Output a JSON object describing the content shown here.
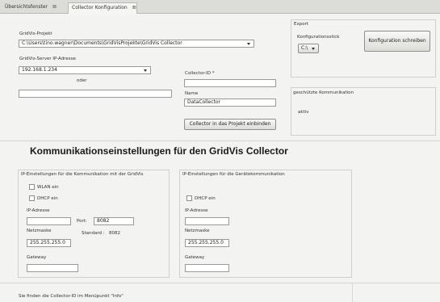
{
  "tabs": [
    {
      "label": "Übersichtsfenster",
      "close": "⊠"
    },
    {
      "label": "Collector Konfiguration",
      "close": "⊠"
    }
  ],
  "gridvis": {
    "project_label": "GridVis-Projekt",
    "project_value": "C:\\Users\\tino.wagner\\Documents\\GridVisProjekte\\GridVis Collector",
    "server_label": "GridVis-Server IP-Adresse",
    "server_value": "192.168.1.234",
    "or_label": "oder",
    "alt_value": ""
  },
  "collector": {
    "id_label": "Collector-ID  *",
    "id_value": "",
    "name_label": "Name",
    "name_value": "DataCollector",
    "embed_button": "Collector in das Projekt einbinden"
  },
  "export": {
    "title": "Export",
    "stick_label": "Konfigurationsstick",
    "drive_value": "C:\\",
    "write_button": "Konfiguration schreiben"
  },
  "secure": {
    "title": "geschützte Kommunikation",
    "status": "aktiv"
  },
  "comm": {
    "heading": "Kommunikationseinstellungen für den GridVis Collector",
    "left": {
      "title": "IP-Einstellungen für die Kommunikation mit der GridVis",
      "wlan_label": "WLAN ein",
      "dhcp_label": "DHCP ein",
      "ip_label": "IP-Adresse",
      "ip_value": "",
      "port_label": "Port:",
      "port_value": "8082",
      "standard_label": "Standard :",
      "standard_value": "8082",
      "netmask_label": "Netzmaske",
      "netmask_value": "255.255.255.0",
      "gateway_label": "Gateway",
      "gateway_value": ""
    },
    "right": {
      "title": "IP-Einstellungen für die Gerätekommunikation",
      "dhcp_label": "DHCP ein",
      "ip_label": "IP-Adresse",
      "ip_value": "",
      "netmask_label": "Netzmaske",
      "netmask_value": "255.255.255.0",
      "gateway_label": "Gateway",
      "gateway_value": ""
    }
  },
  "footer": {
    "info": "Sie finden die Collector-ID im Menüpunkt \"Info\""
  }
}
